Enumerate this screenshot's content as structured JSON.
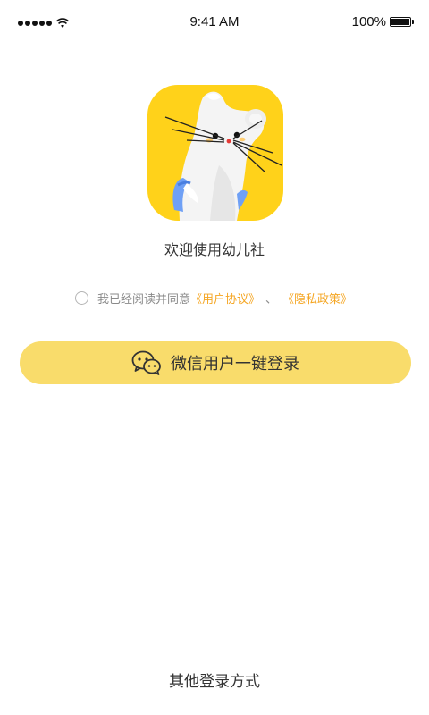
{
  "status_bar": {
    "time": "9:41 AM",
    "battery": "100%",
    "signal_icon": "signal-dots-icon",
    "wifi_icon": "wifi-icon",
    "battery_icon": "battery-icon"
  },
  "app": {
    "icon_name": "mouse-mascot-app-icon",
    "welcome": "欢迎使用幼儿社"
  },
  "agreement": {
    "prefix": "我已经阅读并同意",
    "user_agreement": "《用户协议》",
    "separator": "、",
    "privacy_policy": "《隐私政策》",
    "checked": false
  },
  "login": {
    "wechat_label": "微信用户一键登录",
    "wechat_icon": "wechat-icon",
    "other_methods": "其他登录方式"
  },
  "colors": {
    "brand_yellow": "#FFD21A",
    "button_yellow": "#F9DC6B",
    "link_orange": "#F5A623",
    "text_dark": "#333333",
    "text_muted": "#8a8a8a"
  }
}
